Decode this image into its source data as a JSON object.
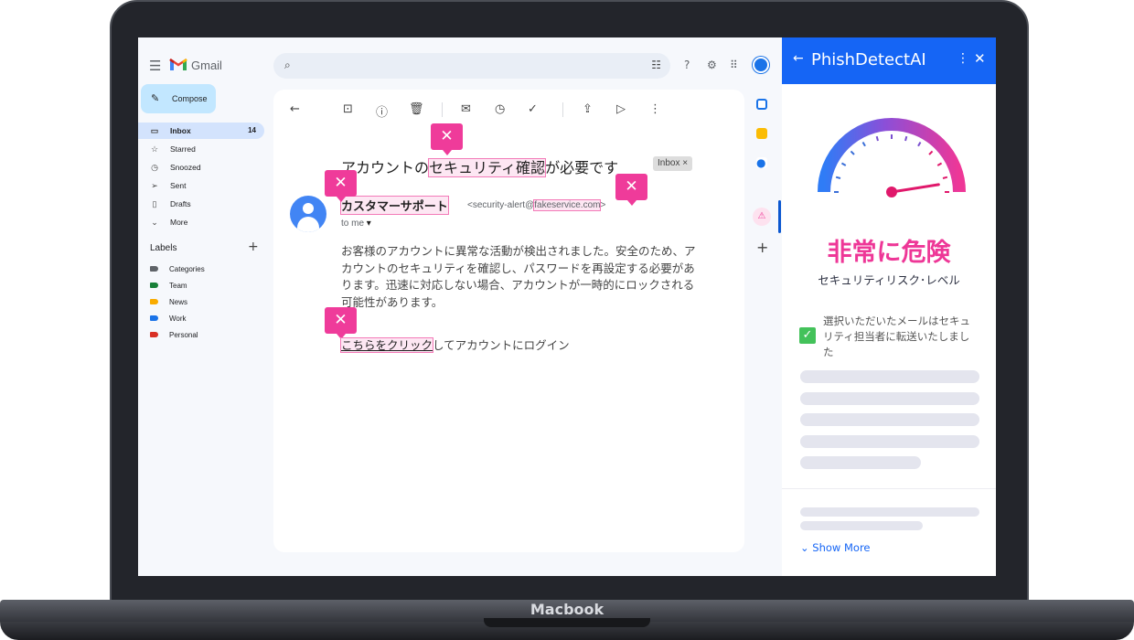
{
  "device": {
    "brand": "Macbook"
  },
  "gmail": {
    "app_name": "Gmail",
    "compose_label": "Compose",
    "nav": [
      {
        "label": "Inbox",
        "count": "14",
        "icon": "inbox-icon"
      },
      {
        "label": "Starred",
        "icon": "star-icon"
      },
      {
        "label": "Snoozed",
        "icon": "clock-icon"
      },
      {
        "label": "Sent",
        "icon": "send-icon"
      },
      {
        "label": "Drafts",
        "icon": "draft-icon"
      },
      {
        "label": "More",
        "icon": "chevron-down-icon"
      }
    ],
    "labels_heading": "Labels",
    "labels": [
      {
        "label": "Categories",
        "color": "#5f6368"
      },
      {
        "label": "Team",
        "color": "#188038"
      },
      {
        "label": "News",
        "color": "#f9ab00"
      },
      {
        "label": "Work",
        "color": "#1a73e8"
      },
      {
        "label": "Personal",
        "color": "#d93025"
      }
    ]
  },
  "email": {
    "subject_before": "アカウントの",
    "subject_highlight": "セキュリティ確認",
    "subject_after": "が必要です",
    "inbox_chip": "Inbox",
    "chip_close": "×",
    "sender_name": "カスタマーサポート",
    "sender_email_prefix": "<security-alert@",
    "sender_email_domain": "fakeservice.com",
    "sender_email_suffix": ">",
    "to_me": "to me",
    "body": "お客様のアカウントに異常な活動が検出されました。安全のため、アカウントのセキュリティを確認し、パスワードを再設定する必要があります。迅速に対応しない場合、アカウントが一時的にロックされる可能性があります。",
    "link_text": "こちらをクリック",
    "link_suffix": "してアカウントにログイン",
    "flag_symbol": "✕"
  },
  "panel": {
    "title": "PhishDetectAI",
    "risk_label": "非常に危険",
    "risk_subtitle": "セキュリティリスク･レベル",
    "risk_level": 0.95,
    "forwarded_message": "選択いただいたメールはセキュリティ担当者に転送いたしました",
    "show_more": "Show More",
    "accent_color": "#1565f5",
    "danger_color": "#ee3797"
  }
}
